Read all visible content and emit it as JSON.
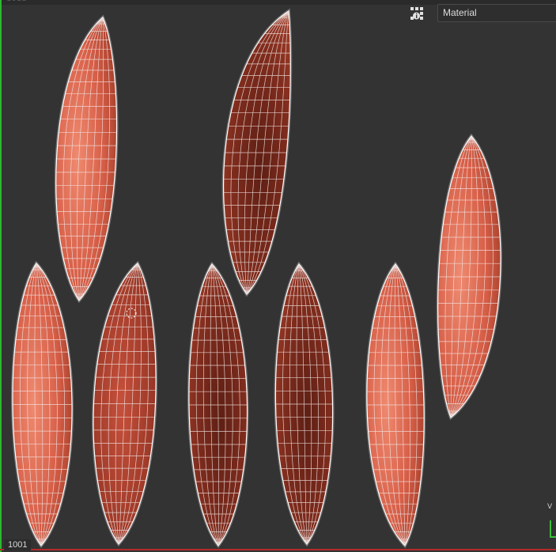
{
  "header": {
    "material_select": {
      "value": "Material"
    },
    "grid_icon": "grid-view-icon"
  },
  "viewport": {
    "tile_label": "1001",
    "top_tile_label": "1011",
    "corner_readout": "V",
    "colors": {
      "background": "#333333",
      "shell_light": "#e87660",
      "shell_mid": "#c24a36",
      "shell_dark": "#6a2518",
      "wire": "#f2e6e4",
      "outline": "#ffffff",
      "frame_left": "#2db82d",
      "frame_bottom": "#b52b2b"
    },
    "cursor_icon": "dashed-circle-cursor-icon"
  },
  "uv_shells": [
    {
      "id": 1,
      "tone": "light"
    },
    {
      "id": 2,
      "tone": "dark"
    },
    {
      "id": 3,
      "tone": "light"
    },
    {
      "id": 4,
      "tone": "light"
    },
    {
      "id": 5,
      "tone": "mid"
    },
    {
      "id": 6,
      "tone": "dark"
    },
    {
      "id": 7,
      "tone": "dark"
    },
    {
      "id": 8,
      "tone": "light"
    }
  ]
}
